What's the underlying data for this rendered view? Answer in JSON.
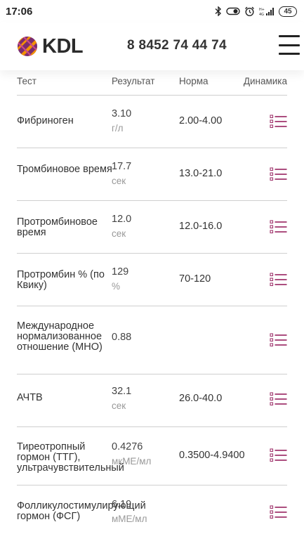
{
  "status_bar": {
    "time": "17:06",
    "battery": "45",
    "icons": [
      "bluetooth-icon",
      "vibrate-icon",
      "alarm-icon",
      "signal-icon",
      "battery-icon"
    ]
  },
  "header": {
    "logo_text": "KDL",
    "phone": "8 8452 74 44 74",
    "menu_icon": "hamburger-menu-icon"
  },
  "colors": {
    "accent": "#a0356d",
    "logo_orange": "#f39200",
    "logo_purple": "#7b2d6e",
    "divider": "#cfcfcf"
  },
  "table": {
    "headers": {
      "test": "Тест",
      "result": "Результат",
      "norm": "Норма",
      "dynamics": "Динамика"
    },
    "rows": [
      {
        "name": "Фибриноген",
        "value": "3.10",
        "unit": "г/л",
        "norm": "2.00-4.00"
      },
      {
        "name": "Тромбиновое время",
        "value": "17.7",
        "unit": "сек",
        "norm": "13.0-21.0"
      },
      {
        "name": "Протромбиновое время",
        "value": "12.0",
        "unit": "сек",
        "norm": "12.0-16.0"
      },
      {
        "name": "Протромбин % (по Квику)",
        "value": "129",
        "unit": "%",
        "norm": "70-120"
      },
      {
        "name": "Международное нормализованное отношение (МНО)",
        "value": "0.88",
        "unit": "",
        "norm": ""
      },
      {
        "name": "АЧТВ",
        "value": "32.1",
        "unit": "сек",
        "norm": "26.0-40.0"
      },
      {
        "name": "Тиреотропный гормон (ТТГ), ультрачувствительный",
        "value": "0.4276",
        "unit": "мкМЕ/мл",
        "norm": "0.3500-4.9400"
      },
      {
        "name": "Фолликулостимулирующий гормон (ФСГ)",
        "value": "6.19",
        "unit": "мМЕ/мл",
        "norm": ""
      }
    ]
  }
}
